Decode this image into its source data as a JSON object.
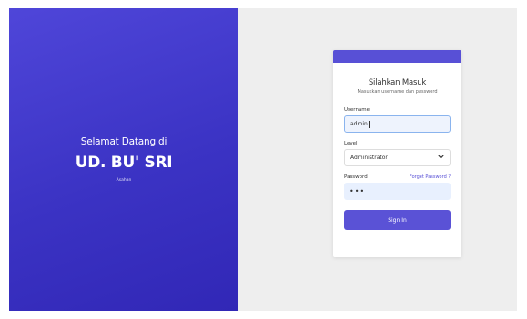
{
  "left": {
    "welcome_text": "Selamat Datang di",
    "brand_name": "UD. BU' SRI",
    "brand_sub": "Asahan"
  },
  "login": {
    "title": "Silahkan Masuk",
    "subtitle": "Masukkan username dan password",
    "username_label": "Username",
    "username_value": "admin",
    "level_label": "Level",
    "level_value": "Administrator",
    "password_label": "Password",
    "forgot_label": "Forget Password ?",
    "password_value": "•••",
    "signin_label": "Sign In"
  },
  "colors": {
    "accent": "#5850d6",
    "left_panel_top": "#4f46d9",
    "left_panel_bottom": "#3127b6",
    "background": "#eeeeee"
  },
  "icons": {
    "select_chevron": "chevron-down-icon"
  }
}
